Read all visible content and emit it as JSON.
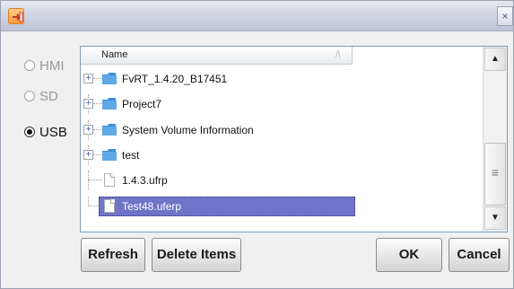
{
  "titlebar": {
    "icon": "exit-arrow-icon",
    "close_label": "×"
  },
  "storage": [
    {
      "label": "HMI",
      "selected": false
    },
    {
      "label": "SD",
      "selected": false
    },
    {
      "label": "USB",
      "selected": true
    }
  ],
  "file_list": {
    "column_header": "Name",
    "sort_indicator": "/\\",
    "rows": [
      {
        "name": "FvRT_1.4.20_B17451",
        "type": "folder"
      },
      {
        "name": "Project7",
        "type": "folder"
      },
      {
        "name": "System Volume Information",
        "type": "folder"
      },
      {
        "name": "test",
        "type": "folder"
      },
      {
        "name": "1.4.3.ufrp",
        "type": "file"
      },
      {
        "name": "Test48.uferp",
        "type": "file",
        "selected": true
      }
    ],
    "scrollbar": {
      "up": "▲",
      "down": "▼"
    }
  },
  "buttons": {
    "refresh": "Refresh",
    "delete": "Delete Items",
    "ok": "OK",
    "cancel": "Cancel"
  },
  "colors": {
    "selection": "#6f74c8",
    "folder": "#3a8fd6",
    "icon_accent": "#ff9a3a"
  }
}
